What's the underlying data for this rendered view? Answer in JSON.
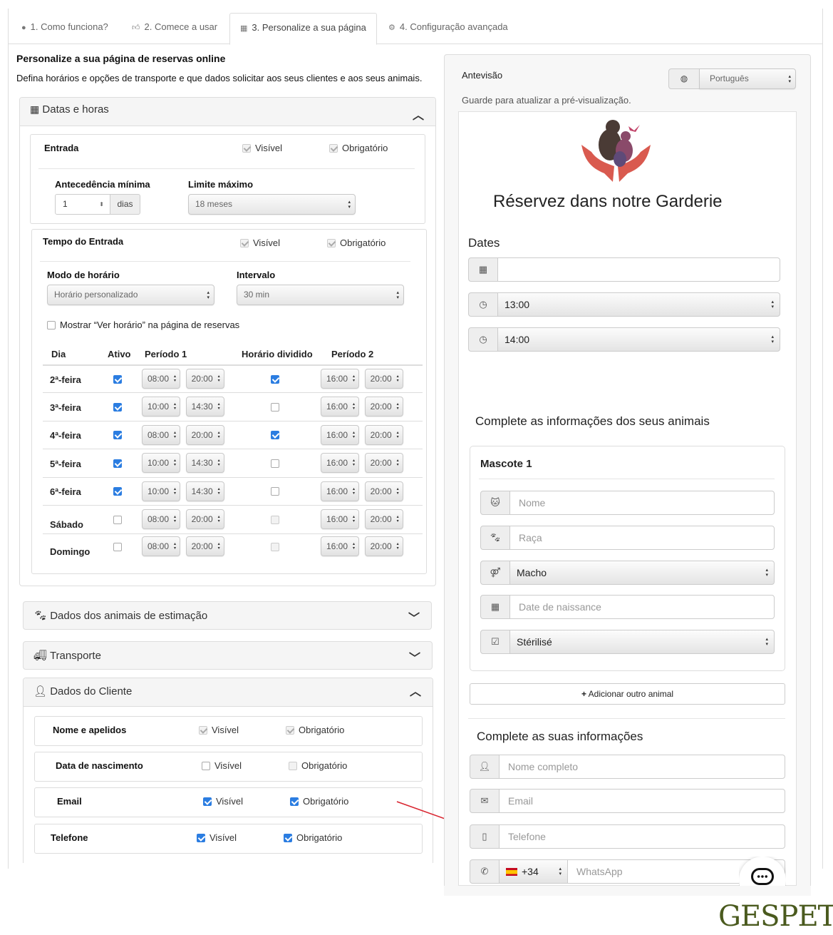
{
  "tabs": [
    {
      "label": "1. Como funciona?",
      "icon": "info-circle-icon"
    },
    {
      "label": "2. Comece a usar",
      "icon": "thumbs-up-icon"
    },
    {
      "label": "3. Personalize a sua página",
      "icon": "calendar-page-icon"
    },
    {
      "label": "4. Configuração avançada",
      "icon": "cogs-icon"
    }
  ],
  "page": {
    "title": "Personalize a sua página de reservas online",
    "subtitle": "Defina horários e opções de transporte e que dados solicitar aos seus clientes e aos seus animais."
  },
  "dates_panel": {
    "title": "Datas e horas",
    "entrada": {
      "label": "Entrada",
      "visible": "Visível",
      "required": "Obrigatório"
    },
    "antecedencia": {
      "label": "Antecedência mínima",
      "value": "1",
      "unit": "dias"
    },
    "limite": {
      "label": "Limite máximo",
      "value": "18 meses"
    },
    "tempo": {
      "label": "Tempo do Entrada",
      "visible": "Visível",
      "required": "Obrigatório"
    },
    "modo": {
      "label": "Modo de horário",
      "value": "Horário personalizado"
    },
    "intervalo": {
      "label": "Intervalo",
      "value": "30 min"
    },
    "mostrar": "Mostrar “Ver horário” na página de reservas",
    "table_headers": [
      "Dia",
      "Ativo",
      "Período 1",
      "Horário dividido",
      "Período 2"
    ],
    "schedule": [
      {
        "day": "2ª-feira",
        "active": true,
        "p1_start": "08:00",
        "p1_end": "20:00",
        "split": true,
        "p2_start": "16:00",
        "p2_end": "20:00"
      },
      {
        "day": "3ª-feira",
        "active": true,
        "p1_start": "10:00",
        "p1_end": "14:30",
        "split": false,
        "p2_start": "16:00",
        "p2_end": "20:00"
      },
      {
        "day": "4ª-feira",
        "active": true,
        "p1_start": "08:00",
        "p1_end": "20:00",
        "split": true,
        "p2_start": "16:00",
        "p2_end": "20:00"
      },
      {
        "day": "5ª-feira",
        "active": true,
        "p1_start": "10:00",
        "p1_end": "14:30",
        "split": false,
        "p2_start": "16:00",
        "p2_end": "20:00"
      },
      {
        "day": "6ª-feira",
        "active": true,
        "p1_start": "10:00",
        "p1_end": "14:30",
        "split": false,
        "p2_start": "16:00",
        "p2_end": "20:00"
      },
      {
        "day": "Sábado",
        "active": false,
        "p1_start": "08:00",
        "p1_end": "20:00",
        "split": false,
        "p2_start": "16:00",
        "p2_end": "20:00"
      },
      {
        "day": "Domingo",
        "active": false,
        "p1_start": "08:00",
        "p1_end": "20:00",
        "split": false,
        "p2_start": "16:00",
        "p2_end": "20:00"
      }
    ]
  },
  "panels": {
    "animais": "Dados dos animais de estimação",
    "transporte": "Transporte",
    "cliente": "Dados do Cliente"
  },
  "client_fields": [
    {
      "label": "Nome e apelidos",
      "visible": "Visível",
      "required": "Obrigatório",
      "visible_on": true,
      "required_on": true,
      "disabled": true
    },
    {
      "label": "Data de nascimento",
      "visible": "Visível",
      "required": "Obrigatório",
      "visible_on": false,
      "required_on": false,
      "disabled": false
    },
    {
      "label": "Email",
      "visible": "Visível",
      "required": "Obrigatório",
      "visible_on": true,
      "required_on": true,
      "disabled": false
    },
    {
      "label": "Telefone",
      "visible": "Visível",
      "required": "Obrigatório",
      "visible_on": true,
      "required_on": true,
      "disabled": false
    }
  ],
  "preview": {
    "label": "Antevisão",
    "language": "Português",
    "hint": "Guarde para atualizar a pré-visualização.",
    "heading": "Réservez dans notre Garderie",
    "dates_title": "Dates",
    "time_start": "13:00",
    "time_end": "14:00",
    "animals_title": "Complete as informações dos seus animais",
    "pet_title": "Mascote 1",
    "pet_name_ph": "Nome",
    "pet_breed_ph": "Raça",
    "pet_sex": "Macho",
    "pet_birth_ph": "Date de naissance",
    "pet_sterilized": "Stérilisé",
    "add_animal": "Adicionar outro animal",
    "client_title": "Complete as suas informações",
    "full_name_ph": "Nome completo",
    "email_ph": "Email",
    "phone_ph": "Telefone",
    "phone_code": "+34",
    "whatsapp_ph": "WhatsApp"
  },
  "brand": "GESPET",
  "colors": {
    "accent": "#2b7de1",
    "arrow": "#d9242f",
    "brand": "#4a5a1e",
    "logo": "#d95a4f"
  }
}
